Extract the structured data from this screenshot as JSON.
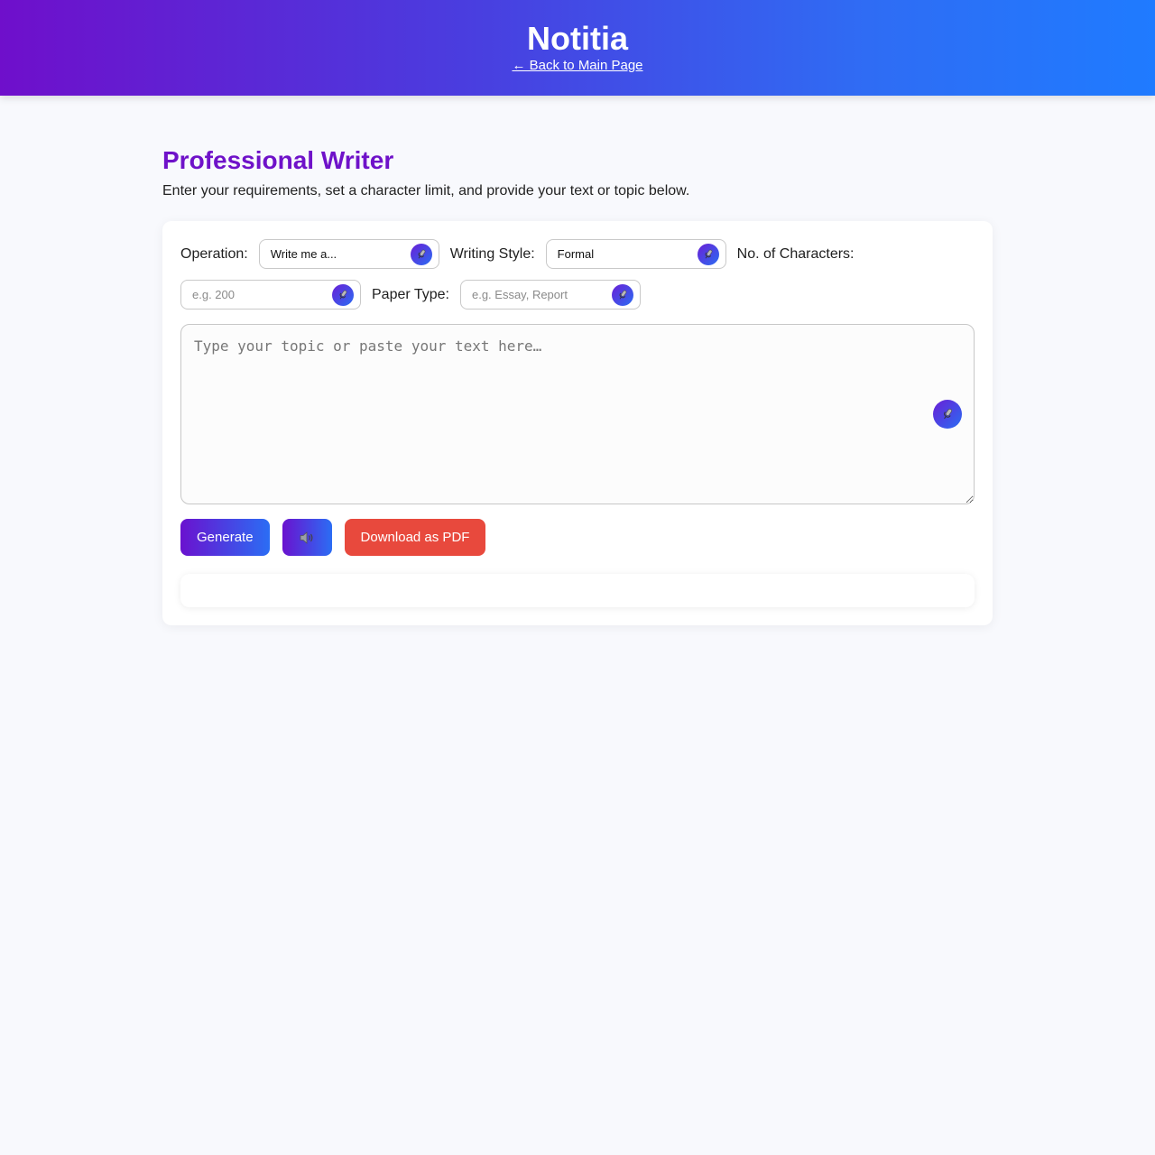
{
  "header": {
    "title": "Notitia",
    "back_link": "← Back to Main Page"
  },
  "page": {
    "title": "Professional Writer",
    "description": "Enter your requirements, set a character limit, and provide your text or topic below."
  },
  "form": {
    "operation": {
      "label": "Operation:",
      "value": "Write me a..."
    },
    "writing_style": {
      "label": "Writing Style:",
      "value": "Formal"
    },
    "num_characters": {
      "label": "No. of Characters:",
      "placeholder": "e.g. 200"
    },
    "paper_type": {
      "label": "Paper Type:",
      "placeholder": "e.g. Essay, Report"
    },
    "topic": {
      "placeholder": "Type your topic or paste your text here…"
    }
  },
  "actions": {
    "generate_label": "Generate",
    "speak_icon": "speaker-icon",
    "download_label": "Download as PDF"
  },
  "icons": {
    "mic": "microphone-icon"
  },
  "colors": {
    "brand_purple": "#6f12c9",
    "brand_blue": "#1f7bff",
    "download_red": "#e8493d",
    "page_background": "#f8f9fd"
  }
}
